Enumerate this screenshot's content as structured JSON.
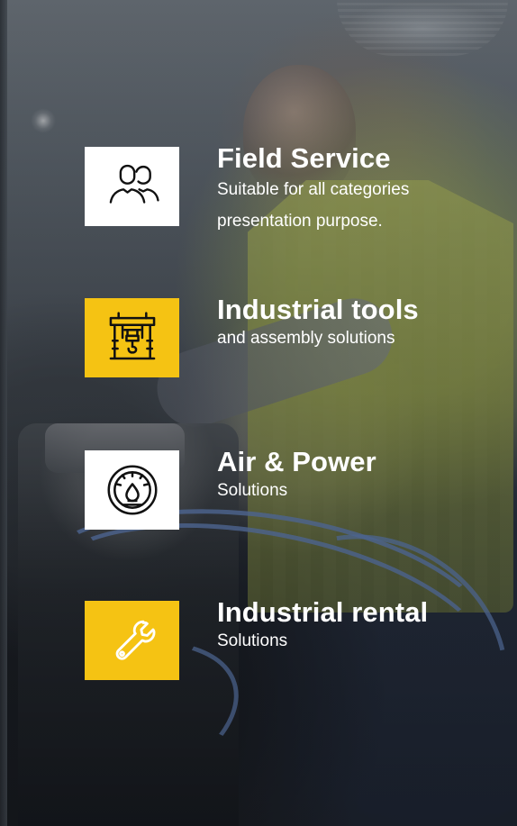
{
  "features": {
    "items": [
      {
        "title": "Field Service",
        "subtitle_line_1": "Suitable for all categories",
        "subtitle_line_2": "presentation purpose.",
        "icon": "users-icon",
        "tile_color": "#ffffff"
      },
      {
        "title": "Industrial tools",
        "subtitle": "and assembly solutions",
        "icon": "crane-hook-icon",
        "tile_color": "#f5c313"
      },
      {
        "title": "Air & Power",
        "subtitle": "Solutions",
        "icon": "pressure-gauge-icon",
        "tile_color": "#ffffff"
      },
      {
        "title": "Industrial rental",
        "subtitle": "Solutions",
        "icon": "wrench-icon",
        "tile_color": "#f5c313"
      }
    ]
  }
}
